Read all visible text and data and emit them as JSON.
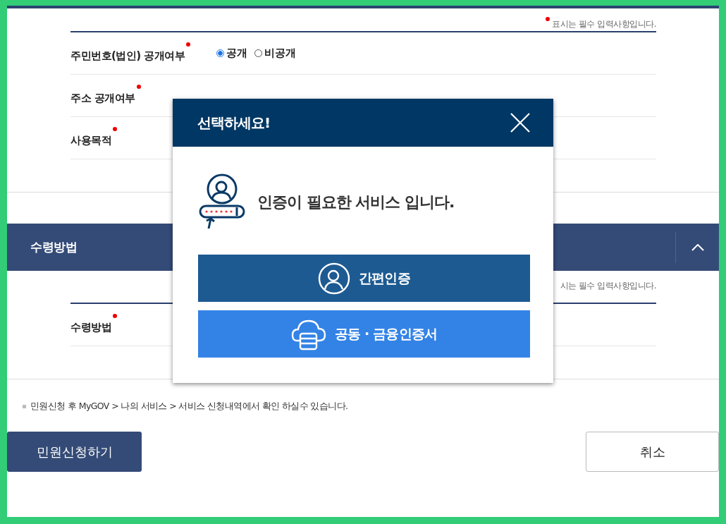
{
  "required_note": "표시는 필수 입력사항입니다.",
  "form_rows": [
    {
      "label": "주민번호(법인) 공개여부",
      "required": true,
      "options": [
        {
          "label": "공개",
          "selected": true
        },
        {
          "label": "비공개",
          "selected": false
        }
      ]
    },
    {
      "label": "주소 공개여부",
      "required": true
    },
    {
      "label": "사용목적",
      "required": true
    }
  ],
  "section": {
    "title": "수령방법",
    "expanded": true,
    "required_note": "시는 필수 입력사항입니다.",
    "rows": [
      {
        "label": "수령방법",
        "required": true
      }
    ]
  },
  "info_note": "민원신청 후 MyGOV > 나의 서비스 > 서비스 신청내역에서 확인 하실수 있습니다.",
  "buttons": [
    {
      "label": "민원신청하기",
      "kind": "primary"
    },
    {
      "label": "취소",
      "kind": "secondary"
    }
  ],
  "modal": {
    "title": "선택하세요!",
    "message": "인증이 필요한 서비스 입니다.",
    "options": [
      {
        "label": "간편인증",
        "kind": "simple"
      },
      {
        "label": "공동 · 금융인증서",
        "kind": "certificate"
      }
    ]
  }
}
